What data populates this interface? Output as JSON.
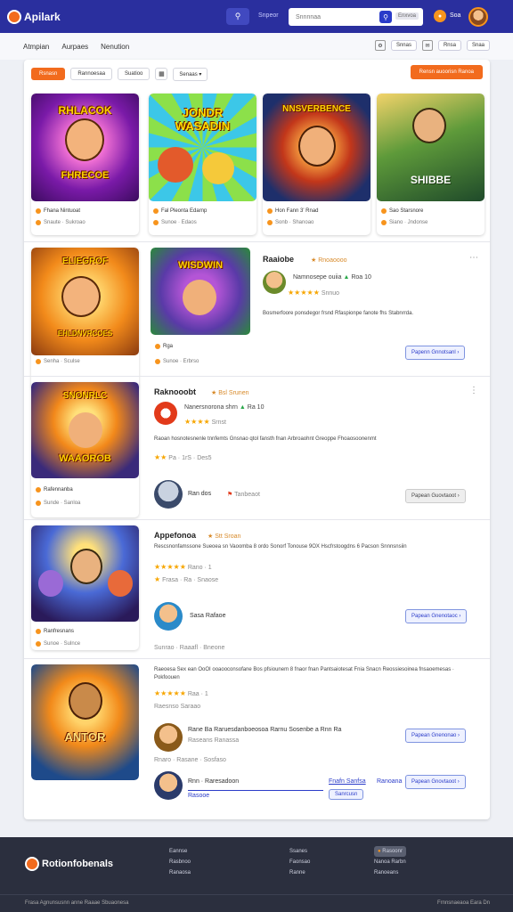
{
  "header": {
    "logo": "Apilark",
    "search_label": "Snpeor",
    "search_placeholder": "Snnnnaa",
    "search_tag": "Enxvoa",
    "user_name": "Soa",
    "colors": {
      "bar": "#2a2f9e",
      "accent": "#f26b1d"
    }
  },
  "subnav": {
    "items": [
      "Atmpian",
      "Aurpaes",
      "Nenution"
    ],
    "right": [
      "Snnas",
      "Rnsa",
      "Snaa"
    ]
  },
  "filters": {
    "active": "Rsnasn",
    "buttons": [
      "Rannoesaa",
      "Suatioo"
    ],
    "sort": "Senaas",
    "cta": "Rensn auoorisn Ranoa"
  },
  "cards": [
    {
      "title": "RHLACOK",
      "subtitle": "FHRECOE",
      "line1": "Fhana Nintuoat",
      "line2": "Snaute · Sukroao"
    },
    {
      "title": "JONDR WASADIN",
      "subtitle": "",
      "line1": "Fal Pleonta Edarnp",
      "line2": "Sunoe · Edaos"
    },
    {
      "title": "NNSVERBENCE",
      "subtitle": "",
      "line1": "Hon Fann 3' Rnad",
      "line2": "Sonb · Shanoao"
    },
    {
      "title": "SHIBBE",
      "subtitle": "",
      "line1": "Sao Starsnore",
      "line2": "Siano · Jndonse"
    }
  ],
  "rows": [
    {
      "title": "Raaiobe",
      "tag": "Rnoaoooo",
      "meta": "Namnosepe ouiia",
      "rating": "Roa 10",
      "rating_sub": "Snnuo",
      "desc": "Bosmerfoore ponsdegor frsnd Rfaspionpe fanote fhs Stabnrrda.",
      "left_cards": [
        {
          "title": "ELIEGROF",
          "subtitle": "EHLDNVRCOES",
          "line2": "Senha · Sculse"
        },
        {
          "title": "WISDWIN",
          "line1": "Rga",
          "line2": "Sunoe · Erbrso"
        }
      ],
      "button": "Papenn Gnnotsanl"
    },
    {
      "title": "Raknooobt",
      "tag": "Bsl Srunen",
      "meta": "Nanersnorona shrn",
      "rating": "Ra 10",
      "rating_sub": "Srnst",
      "desc": "Raoan hosnotesnenle tnnfemts Gnsnao qtol fansth fnan Arbroaohnt Greoppe Fhoaosoonenmt",
      "extra": "Pa · 1rS · Des5",
      "card": {
        "title": "SNONRLC",
        "subtitle": "WAAOROB",
        "line1": "Rafennanba",
        "line2": "Sunde · Sanloa"
      },
      "author": "Ran dos",
      "author_tag": "Tanbeaot",
      "button": "Papean Guovtaoot"
    },
    {
      "title": "Appefonoa",
      "tag": "Stt Sroan",
      "desc": "Rescsnonfamssone Sueoea sn Vaoomba 8 ordo Sonorf Tonouse 9OX Hscfrstoogdns 6 Pacson Snnnsnsiin",
      "rating": "Rano · 1",
      "extra": "Frasa · Ra · Snaose",
      "card": {
        "title": "",
        "line1": "Ranfresnans",
        "line2": "Sunoe · Sulnce"
      },
      "author": "Sasa Rafaoe",
      "footnote": "Sunrao · Raaafl · Bneone",
      "button": "Papean Gnenotaoc"
    },
    {
      "title": "",
      "desc": "Raeoesa Sex ean OoOI ooaooconsofane Bos pfsiounem 8 fnaor fnan Pantsaiotesat Fnia Snacn Reossiesoinea fnsaoemesas · Pokfoouen",
      "rating": "Raa · 1",
      "extra": "Raesnso Saraao",
      "card": {
        "title": "ANTOR"
      },
      "author_line": "Rane Ba Raruesdanboeosoa Rarnu Sosenbe a Rnn Ra",
      "author_sub": "Raseans Ranassa",
      "author_sub2": "Rnaro · Rasane · Sosfaso",
      "author2": "Rnn · Raresadoon",
      "author2_sub": "Rasooe",
      "tags": [
        "Fnafn Sanfsa",
        "Ranoana"
      ],
      "button_a": "Papean Gnenonao",
      "button_b": "Papean Gnovtaoot",
      "small_button": "Sanrcusn"
    }
  ],
  "footer": {
    "logo": "Rotionfobenals",
    "col1": [
      "Eannse",
      "Rasbnoo",
      "Ranaosa"
    ],
    "col2": [
      "Ssanes",
      "Faonsao",
      "Ranne"
    ],
    "col3_badge": "Rasoonr",
    "col3": [
      "Nanoa Rarbn",
      "Ranoeans"
    ],
    "copyright": "Frasa Agnunsusnn anne Raaae Sbuaonesa",
    "right": "Frnnsnaeaoa  Eara  Dn"
  }
}
